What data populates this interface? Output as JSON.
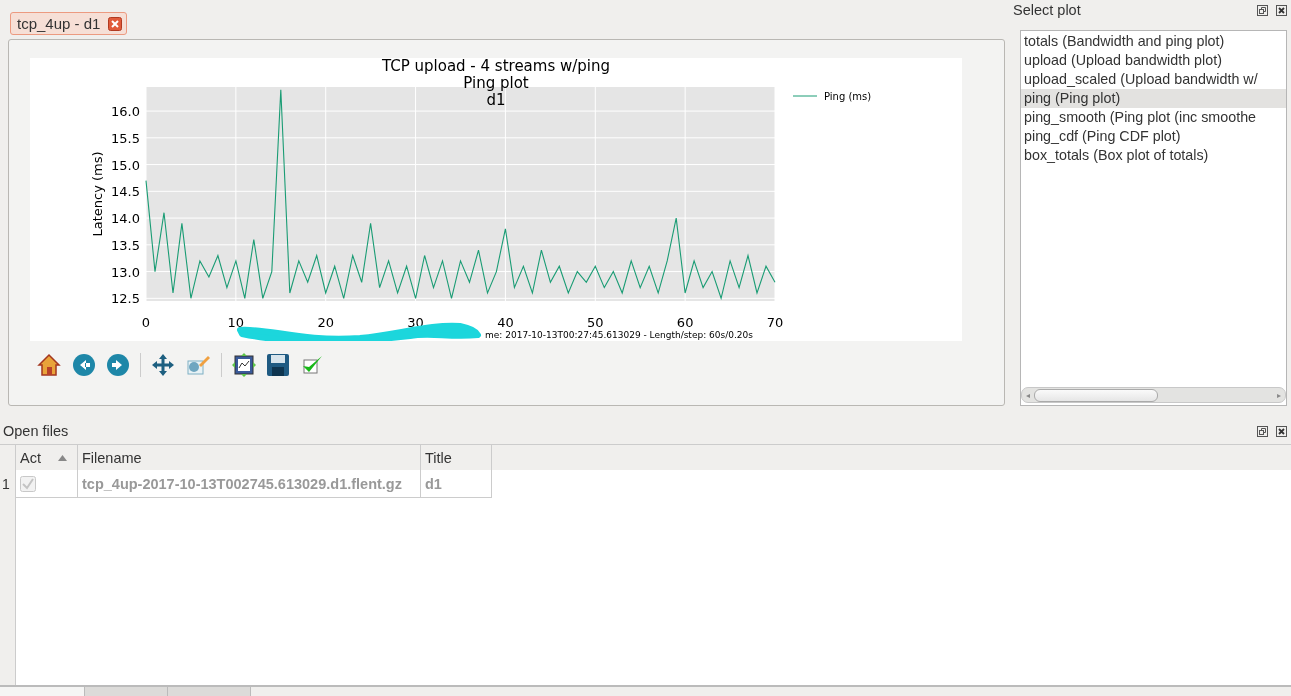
{
  "document_tabs": [
    {
      "label": "tcp_4up - d1",
      "selected": true
    }
  ],
  "plot": {
    "subtitle_lines": [
      "Ping plot",
      "d1"
    ],
    "footer": "me: 2017-10-13T00:27:45.613029 - Length/step: 60s/0.20s",
    "chart_data": {
      "type": "line",
      "title": "TCP upload - 4 streams w/ping",
      "ylabel": "Latency (ms)",
      "xlim": [
        0,
        70
      ],
      "ylim": [
        12.45,
        16.45
      ],
      "xticks": [
        0,
        10,
        20,
        30,
        40,
        50,
        60,
        70
      ],
      "yticks": [
        12.5,
        {
          "value": 13,
          "label": "13.0"
        },
        13.5,
        {
          "value": 14,
          "label": "14.0"
        },
        14.5,
        {
          "value": 15,
          "label": "15.0"
        },
        15.5,
        {
          "value": 16,
          "label": "16.0"
        }
      ],
      "grid": true,
      "x": [
        0,
        1,
        2,
        3,
        4,
        5,
        6,
        7,
        8,
        9,
        10,
        11,
        12,
        13,
        14,
        15,
        16,
        17,
        18,
        19,
        20,
        21,
        22,
        23,
        24,
        25,
        26,
        27,
        28,
        29,
        30,
        31,
        32,
        33,
        34,
        35,
        36,
        37,
        38,
        39,
        40,
        41,
        42,
        43,
        44,
        45,
        46,
        47,
        48,
        49,
        50,
        51,
        52,
        53,
        54,
        55,
        56,
        57,
        58,
        59,
        60,
        61,
        62,
        63,
        64,
        65,
        66,
        67,
        68,
        69,
        70
      ],
      "series": [
        {
          "name": "Ping (ms)",
          "color": "#1a9c74",
          "values": [
            14.7,
            13.0,
            14.1,
            12.6,
            13.9,
            12.5,
            13.2,
            12.9,
            13.3,
            12.7,
            13.2,
            12.5,
            13.6,
            12.5,
            13.0,
            16.4,
            12.6,
            13.2,
            12.8,
            13.3,
            12.6,
            13.1,
            12.5,
            13.3,
            12.8,
            13.9,
            12.7,
            13.2,
            12.6,
            13.1,
            12.5,
            13.3,
            12.7,
            13.2,
            12.5,
            13.2,
            12.8,
            13.4,
            12.6,
            13.0,
            13.8,
            12.7,
            13.1,
            12.6,
            13.4,
            12.8,
            13.1,
            12.6,
            13.0,
            12.8,
            13.1,
            12.7,
            13.0,
            12.6,
            13.2,
            12.7,
            13.1,
            12.6,
            13.2,
            14.0,
            12.6,
            13.2,
            12.7,
            13.0,
            12.5,
            13.2,
            12.7,
            13.3,
            12.6,
            13.1,
            12.8
          ]
        }
      ]
    }
  },
  "select_plot": {
    "title": "Select plot",
    "items": [
      {
        "label": "totals (Bandwidth and ping plot)",
        "selected": false
      },
      {
        "label": "upload (Upload bandwidth plot)",
        "selected": false
      },
      {
        "label": "upload_scaled (Upload bandwidth w/",
        "selected": false
      },
      {
        "label": "ping (Ping plot)",
        "selected": true
      },
      {
        "label": "ping_smooth (Ping plot (inc smoothe",
        "selected": false
      },
      {
        "label": "ping_cdf (Ping CDF plot)",
        "selected": false
      },
      {
        "label": "box_totals (Box plot of totals)",
        "selected": false
      }
    ]
  },
  "open_files": {
    "title": "Open files",
    "columns": [
      {
        "label": "Act",
        "sort_ascending": true
      },
      {
        "label": "Filename",
        "sort_ascending": false
      },
      {
        "label": "Title",
        "sort_ascending": false
      }
    ],
    "rows": [
      {
        "number": "1",
        "checked": true,
        "disabled": true,
        "filename": "tcp_4up-2017-10-13T002745.613029.d1.flent.gz",
        "title": "d1"
      }
    ]
  },
  "scrollbar": {
    "left_arrow": "◂",
    "right_arrow": "▸"
  },
  "bottom_tabs": [
    {
      "selected": true
    },
    {
      "selected": false
    },
    {
      "selected": false
    }
  ]
}
